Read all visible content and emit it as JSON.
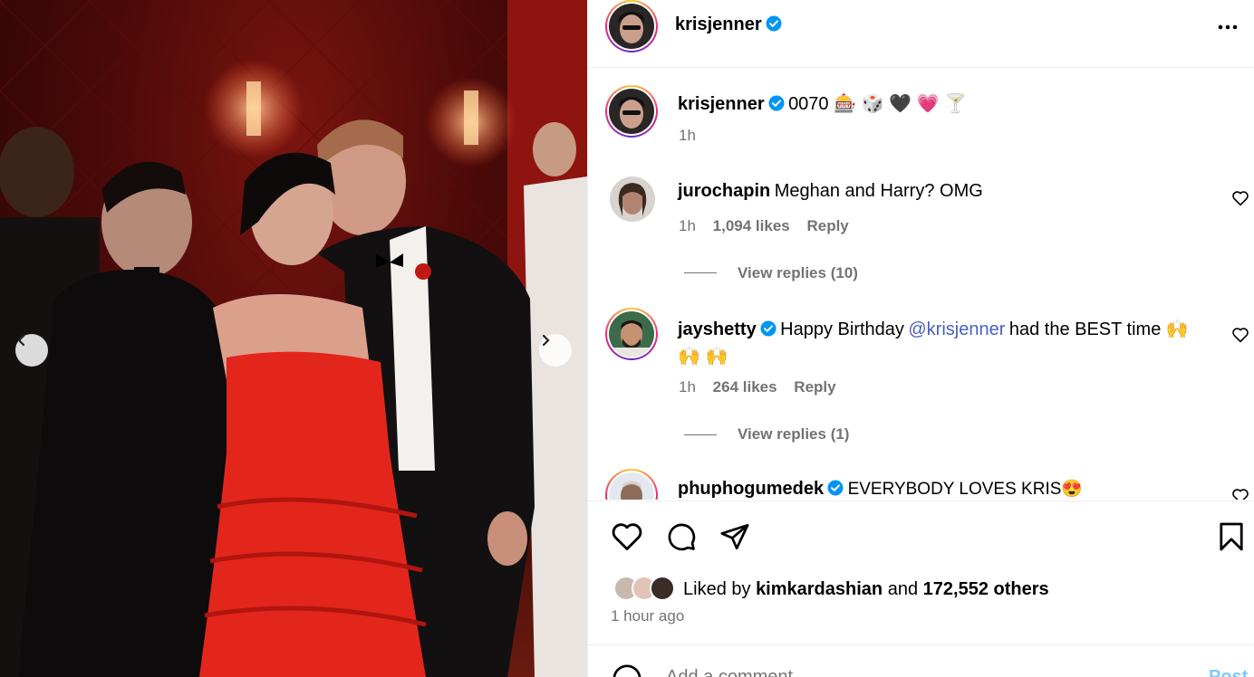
{
  "header": {
    "username": "krisjenner",
    "menu_icon": "more-horizontal-icon"
  },
  "caption": {
    "username": "krisjenner",
    "text": "0070 🎰 🎲 🖤 💗 🍸",
    "time": "1h"
  },
  "comments": [
    {
      "username": "jurochapin",
      "text": "Meghan and Harry? OMG",
      "time": "1h",
      "likes": "1,094 likes",
      "reply_label": "Reply",
      "view_replies": "View replies (10)"
    },
    {
      "username": "jayshetty",
      "text_before": "Happy Birthday",
      "mention": "@krisjenner",
      "text_after": "had the BEST time 🙌",
      "text_line2": "🙌 🙌",
      "time": "1h",
      "likes": "264 likes",
      "reply_label": "Reply",
      "view_replies": "View replies (1)"
    },
    {
      "username": "phuphogumedek",
      "text": "EVERYBODY LOVES KRIS😍"
    }
  ],
  "actions": {
    "liked_by_prefix": "Liked by",
    "liked_by_user": "kimkardashian",
    "liked_by_and": "and",
    "liked_by_count": "172,552 others",
    "time_ago": "1 hour ago"
  },
  "add_comment": {
    "placeholder": "Add a comment…",
    "post_label": "Post"
  },
  "colors": {
    "accent_link": "#4a5fc1",
    "verified": "#0095f6",
    "muted": "#737373"
  }
}
